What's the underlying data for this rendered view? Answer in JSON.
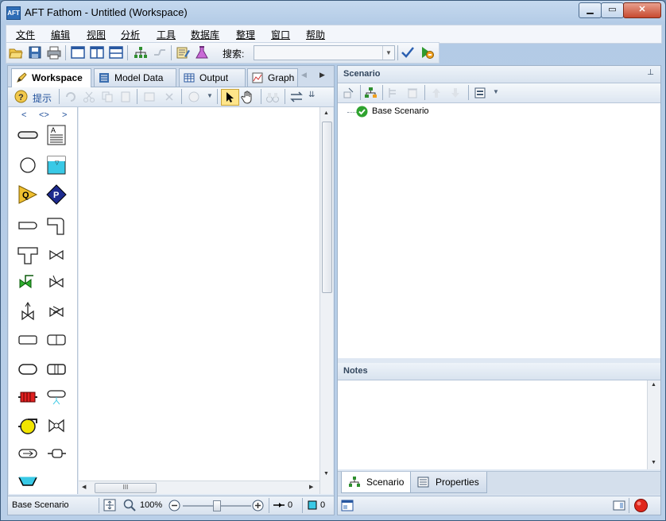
{
  "window": {
    "title": "AFT Fathom - Untitled (Workspace)",
    "app_icon": "AFT"
  },
  "menu": [
    "文件",
    "编辑",
    "视图",
    "分析",
    "工具",
    "数据库",
    "整理",
    "窗口",
    "帮助"
  ],
  "toolbar": {
    "search_label": "搜索:",
    "search_value": ""
  },
  "tabs": [
    {
      "label": "Workspace",
      "active": true
    },
    {
      "label": "Model Data",
      "active": false
    },
    {
      "label": "Output",
      "active": false
    },
    {
      "label": "Graph",
      "active": false
    }
  ],
  "workspace_toolbar": {
    "hint_label": "提示"
  },
  "palette": {
    "nav_prev": "<",
    "nav_both": "<>",
    "nav_next": ">"
  },
  "hscroll_grip": "III",
  "status": {
    "scenario": "Base Scenario",
    "zoom": "100%",
    "pipe_count": "0",
    "junction_count": "0"
  },
  "scenario_panel": {
    "title": "Scenario",
    "pin": "📌",
    "tree": [
      {
        "label": "Base Scenario",
        "status": "ok"
      }
    ]
  },
  "notes_panel": {
    "title": "Notes",
    "text": ""
  },
  "bottom_tabs": [
    {
      "label": "Scenario",
      "active": true
    },
    {
      "label": "Properties",
      "active": false
    }
  ],
  "colors": {
    "accent": "#3a74c4",
    "status_ok": "#2fa32f",
    "record": "#e0261b"
  }
}
